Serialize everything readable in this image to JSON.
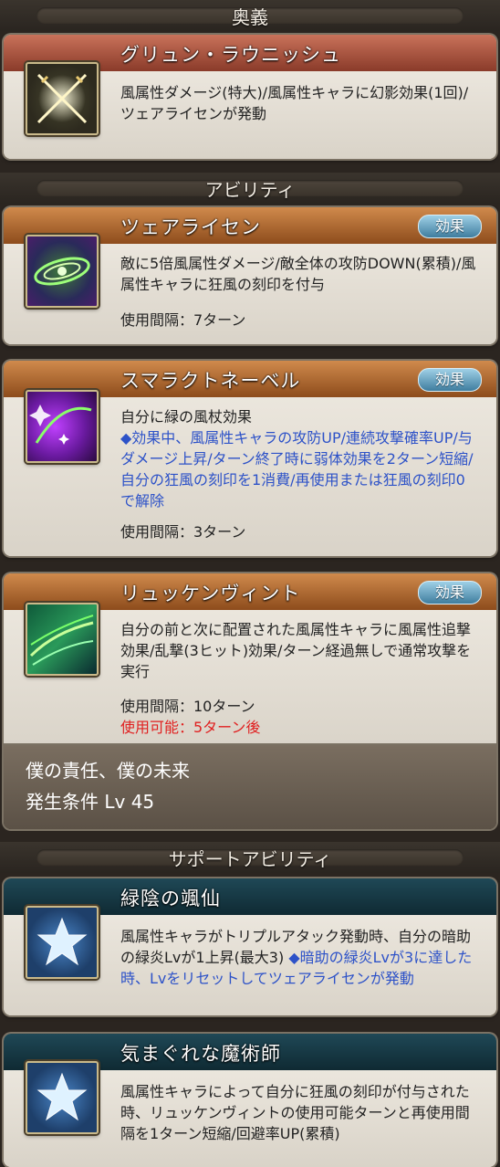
{
  "sections": {
    "ougi": "奥義",
    "ability": "アビリティ",
    "support": "サポートアビリティ"
  },
  "effect_label": "効果",
  "ougi": {
    "name": "グリュン・ラウニッシュ",
    "desc": "風属性ダメージ(特大)/風属性キャラに幻影効果(1回)/ツェアライセンが発動",
    "icon": "crossed-swords-icon"
  },
  "abilities": [
    {
      "name": "ツェアライセン",
      "desc": "敵に5倍風属性ダメージ/敵全体の攻防DOWN(累積)/風属性キャラに狂風の刻印を付与",
      "cooldown": "使用間隔：7ターン",
      "icon": "green-vortex-icon"
    },
    {
      "name": "スマラクトネーベル",
      "desc": "自分に緑の風杖効果",
      "desc_blue": "◆効果中、風属性キャラの攻防UP/連続攻撃確率UP/与ダメージ上昇/ターン終了時に弱体効果を2ターン短縮/自分の狂風の刻印を1消費/再使用または狂風の刻印0で解除",
      "cooldown": "使用間隔：3ターン",
      "icon": "purple-sparkle-icon"
    },
    {
      "name": "リュッケンヴィント",
      "desc": "自分の前と次に配置された風属性キャラに風属性追撃効果/乱撃(3ヒット)効果/ターン経過無しで通常攻撃を実行",
      "cooldown": "使用間隔：10ターン",
      "availability": "使用可能：5ターン後",
      "icon": "green-wind-icon"
    }
  ],
  "unlock": {
    "name": "僕の責任、僕の未来",
    "condition": "発生条件 Lv 45"
  },
  "support": [
    {
      "name": "緑陰の颯仙",
      "desc": "風属性キャラがトリプルアタック発動時、自分の暗助の緑炎Lvが1上昇(最大3)",
      "desc_blue": "◆暗助の緑炎Lvが3に達した時、Lvをリセットしてツェアライセンが発動",
      "icon": "star-icon"
    },
    {
      "name": "気まぐれな魔術師",
      "desc": "風属性キャラによって自分に狂風の刻印が付与された時、リュッケンヴィントの使用可能ターンと再使用間隔を1ターン短縮/回避率UP(累積)",
      "icon": "star-icon"
    }
  ]
}
